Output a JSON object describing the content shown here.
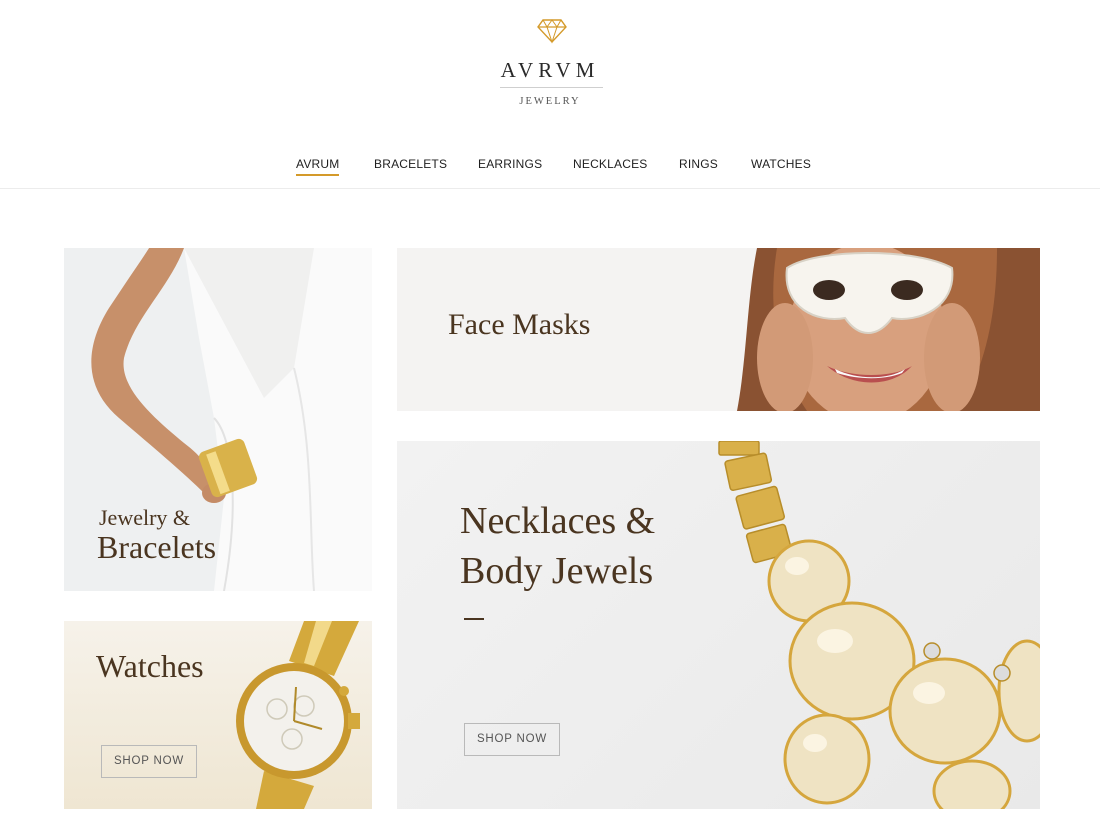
{
  "brand": {
    "name": "AVRVM",
    "subtitle": "JEWELRY",
    "accent_color": "#d49a2a",
    "logo_icon": "diamond-icon"
  },
  "nav": {
    "items": [
      {
        "label": "AVRUM",
        "active": true
      },
      {
        "label": "BRACELETS",
        "active": false
      },
      {
        "label": "EARRINGS",
        "active": false
      },
      {
        "label": "NECKLACES",
        "active": false
      },
      {
        "label": "RINGS",
        "active": false
      },
      {
        "label": "WATCHES",
        "active": false
      }
    ]
  },
  "tiles": {
    "bracelets": {
      "line1": "Jewelry &",
      "line2": "Bracelets"
    },
    "masks": {
      "title": "Face Masks"
    },
    "watches": {
      "title": "Watches",
      "button": "SHOP NOW"
    },
    "necklaces": {
      "line1": "Necklaces &",
      "line2": "Body Jewels",
      "button": "SHOP NOW"
    }
  }
}
